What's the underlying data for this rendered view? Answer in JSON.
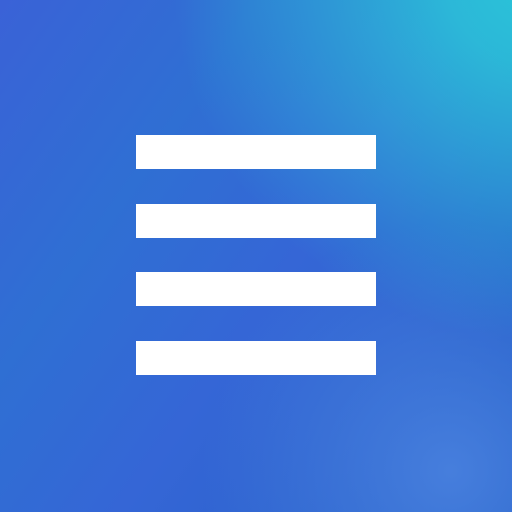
{
  "icon": {
    "name": "hamburger-menu-icon",
    "line_count": 4,
    "line_color": "#ffffff",
    "gradient_colors": [
      "#2ac6d8",
      "#3a62d7",
      "#1f5cc4"
    ]
  }
}
